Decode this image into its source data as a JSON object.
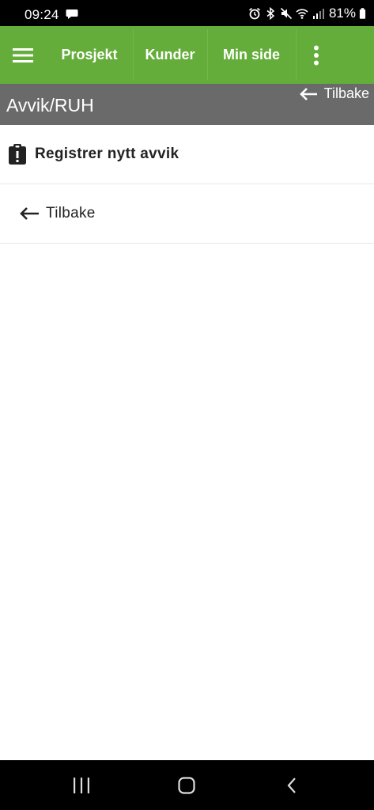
{
  "status_bar": {
    "time": "09:24",
    "battery_percent": "81%"
  },
  "app_bar": {
    "nav_items": [
      {
        "label": "Prosjekt"
      },
      {
        "label": "Kunder"
      },
      {
        "label": "Min side"
      }
    ],
    "icons": {
      "menu": "hamburger-icon",
      "overflow": "more-vert-icon"
    }
  },
  "title_bar": {
    "title": "Avvik/RUH",
    "back_label": "Tilbake"
  },
  "content": {
    "register_label": "Registrer nytt avvik",
    "back_label": "Tilbake"
  },
  "colors": {
    "app_bar_green": "#64ad3a",
    "title_bar_gray": "#6a6a6a",
    "status_bar": "#000000"
  }
}
